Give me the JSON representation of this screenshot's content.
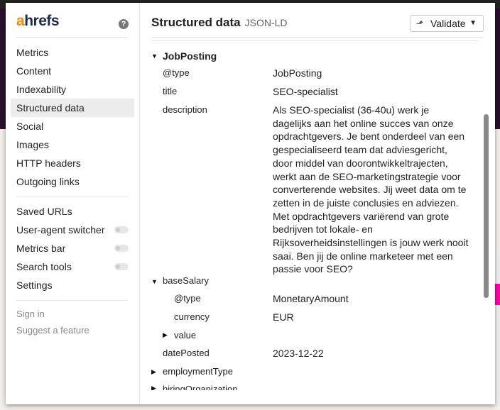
{
  "logo": {
    "prefix": "a",
    "rest": "hrefs"
  },
  "help_icon": "?",
  "nav": {
    "items": [
      "Metrics",
      "Content",
      "Indexability",
      "Structured data",
      "Social",
      "Images",
      "HTTP headers",
      "Outgoing links"
    ],
    "active": "Structured data"
  },
  "tools": [
    {
      "label": "Saved URLs"
    },
    {
      "label": "User-agent switcher",
      "toggle": false
    },
    {
      "label": "Metrics bar",
      "toggle": false
    },
    {
      "label": "Search tools",
      "toggle": false
    },
    {
      "label": "Settings"
    }
  ],
  "footer": [
    "Sign in",
    "Suggest a feature"
  ],
  "header": {
    "title": "Structured data",
    "subtitle": "JSON-LD",
    "validate_label": "Validate"
  },
  "schema": {
    "root": "JobPosting",
    "type_key": "@type",
    "type_val": "JobPosting",
    "title_key": "title",
    "title_val": "SEO-specialist",
    "desc_key": "description",
    "desc_lines": [
      "Als SEO-specialist (36-40u) werk je",
      "dagelijks aan het online succes van onze",
      "opdrachtgevers. Je bent onderdeel van een",
      "gespecialiseerd team dat adviesgericht,",
      "door middel van doorontwikkeltrajecten,",
      "werkt aan de SEO-marketingstrategie voor",
      "converterende websites. Jij weet data om te",
      "zetten in de juiste conclusies en adviezen.",
      "Met opdrachtgevers variërend van grote",
      "bedrijven tot lokale- en",
      "Rijksoverheidsinstellingen is jouw werk nooit",
      "saai. Ben jij de online marketeer met een",
      "passie voor SEO?"
    ],
    "salary_key": "baseSalary",
    "salary_type_key": "@type",
    "salary_type_val": "MonetaryAmount",
    "currency_key": "currency",
    "currency_val": "EUR",
    "value_key": "value",
    "date_key": "datePosted",
    "date_val": "2023-12-22",
    "employment_key": "employmentType",
    "org_key": "hiringOrganization"
  }
}
